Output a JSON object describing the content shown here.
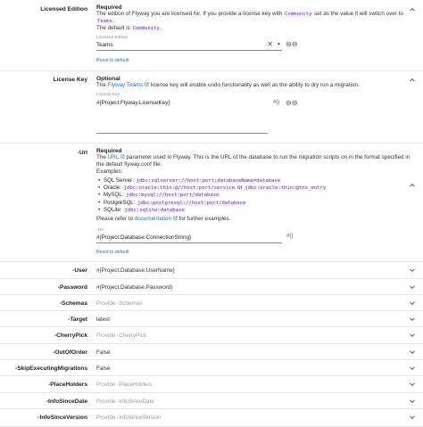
{
  "licensed_edition": {
    "label": "Licensed Edition",
    "required": "Required",
    "desc_1": "The edition of Flyway you are licensed for. If you provide a license key with",
    "code_community": "Community",
    "desc_2": "set as the value it will switch over to",
    "code_teams": "Teams",
    "default_text": "The default is",
    "code_default": "Community",
    "field_label": "Licensed Edition",
    "field_value": "Teams",
    "reset": "Reset to default"
  },
  "license_key": {
    "label": "License Key",
    "optional": "Optional",
    "desc_pre": "The",
    "link": "Flyway Teams",
    "desc_post": "license key will enable undo functionality as well as the ability to dry run a migration.",
    "field_label": "License Key",
    "field_value": "#{Project.Flyway.LicenseKey}",
    "var_icon": "#()"
  },
  "url": {
    "label": "-Url",
    "required": "Required",
    "desc_pre": "The",
    "link": "URL",
    "desc_post": "parameter used in Flyway. This is the URL of the database to run the migration scripts on in the format specified in the default flyway.conf file.",
    "examples_label": "Examples:",
    "examples": [
      {
        "name": "SQL Server:",
        "code": "jdbc:sqlserver://host:port;databaseName=database",
        "or": "",
        "code2": ""
      },
      {
        "name": "Oracle:",
        "code": "jdbc:oracle:thin:@//host:port/service",
        "or": "or",
        "code2": "jdbc:oracle:thin:@tns_entry"
      },
      {
        "name": "MySQL:",
        "code": "jdbc:mysql://host:port/database",
        "or": "",
        "code2": ""
      },
      {
        "name": "PostgreSQL:",
        "code": "jdbc:postgresql://host:port/database",
        "or": "",
        "code2": ""
      },
      {
        "name": "SQLite:",
        "code": "jdbc:sqlite:database",
        "or": "",
        "code2": ""
      }
    ],
    "refer_pre": "Please refer to",
    "refer_link": "documentation",
    "refer_post": "for further examples.",
    "field_label": "-Url",
    "field_value": "#{Project.Database.ConnectionString}",
    "var_icon": "#()",
    "reset": "Reset to default"
  },
  "rows": [
    {
      "label": "-User",
      "value": "#{Project.Database.UserName}",
      "placeholder": false
    },
    {
      "label": "-Password",
      "value": "#{Project.Database.Password}",
      "placeholder": false
    },
    {
      "label": "-Schemas",
      "value": "Provide -Schemas",
      "placeholder": true
    },
    {
      "label": "-Target",
      "value": "latest",
      "placeholder": false
    },
    {
      "label": "-CherryPick",
      "value": "Provide -CherryPick",
      "placeholder": true
    },
    {
      "label": "-OutOfOrder",
      "value": "False",
      "placeholder": false
    },
    {
      "label": "-SkipExecutingMigrations",
      "value": "False",
      "placeholder": false
    },
    {
      "label": "-PlaceHolders",
      "value": "Provide -PlaceHolders",
      "placeholder": true
    },
    {
      "label": "-InfoSinceDate",
      "value": "Provide -InfoSinceDate",
      "placeholder": true
    },
    {
      "label": "-InfoSinceVersion",
      "value": "Provide -InfoSinceVersion",
      "placeholder": true
    }
  ]
}
